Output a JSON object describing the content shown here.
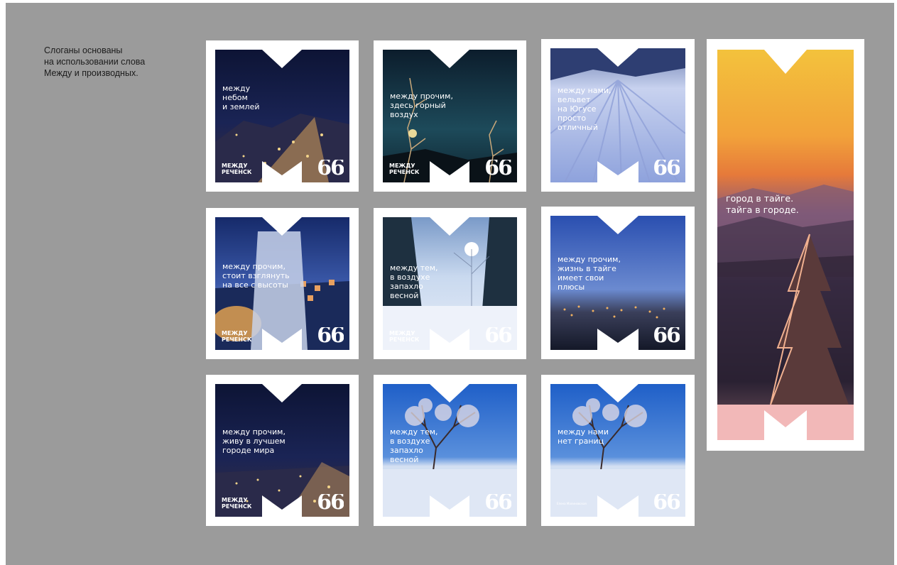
{
  "intro": {
    "lines": [
      "Слоганы основаны",
      "на использовании слова",
      "Между и производных."
    ]
  },
  "colors": {
    "board": "#9b9b9b",
    "card_frame": "#ffffff",
    "brand_blue": "#2c4a9a"
  },
  "cards": [
    {
      "id": "c1",
      "lines": [
        "между",
        "небом",
        "и землей"
      ],
      "brand": [
        "МЕЖДУ",
        "РЕЧЕНСК"
      ],
      "quote": "66",
      "scene": "night city street"
    },
    {
      "id": "c2",
      "lines": [
        "между прочим,",
        "здесь горный",
        "воздух"
      ],
      "brand": [
        "МЕЖДУ",
        "РЕЧЕНСК"
      ],
      "quote": "66",
      "scene": "night branches"
    },
    {
      "id": "c3",
      "lines": [
        "между нами,",
        "вельвет",
        "на Югусе",
        "просто",
        "отличный"
      ],
      "brand": [],
      "quote": "66",
      "scene": "groomed snow slope"
    },
    {
      "id": "c4",
      "lines": [
        "между прочим,",
        "стоит взглянуть",
        "на все с высоты"
      ],
      "brand": [
        "МЕЖДУ",
        "РЕЧЕНСК"
      ],
      "quote": "66",
      "scene": "snowy rooftop at night"
    },
    {
      "id": "c5",
      "lines": [
        "между тем,",
        "в воздухе",
        "запахло",
        "весной"
      ],
      "brand": [
        "МЕЖДУ",
        "РЕЧЕНСК"
      ],
      "quote": "66",
      "scene": "winter forest sun"
    },
    {
      "id": "c6",
      "lines": [
        "между прочим,",
        "жизнь в тайге",
        "имеет свои",
        "плюсы"
      ],
      "brand": [],
      "quote": "66",
      "scene": "evening valley city"
    },
    {
      "id": "c7",
      "lines": [
        "между прочим,",
        "живу в лучшем",
        "городе мира"
      ],
      "brand": [
        "МЕЖДУ",
        "РЕЧЕНСК"
      ],
      "quote": "66",
      "scene": "night city street"
    },
    {
      "id": "c8",
      "lines": [
        "между тем,",
        "в воздухе",
        "запахло",
        "весной"
      ],
      "brand": [],
      "quote": "66",
      "scene": "frosted tree blue sky"
    },
    {
      "id": "c9",
      "lines": [
        "между нами",
        "нет границ"
      ],
      "brand": [
        "Елена Малиновская"
      ],
      "quote": "66",
      "scene": "frosted tree blue sky"
    }
  ],
  "tall_card": {
    "lines": [
      "город в тайге.",
      "тайга в городе."
    ],
    "scene": "sunset over taiga"
  }
}
